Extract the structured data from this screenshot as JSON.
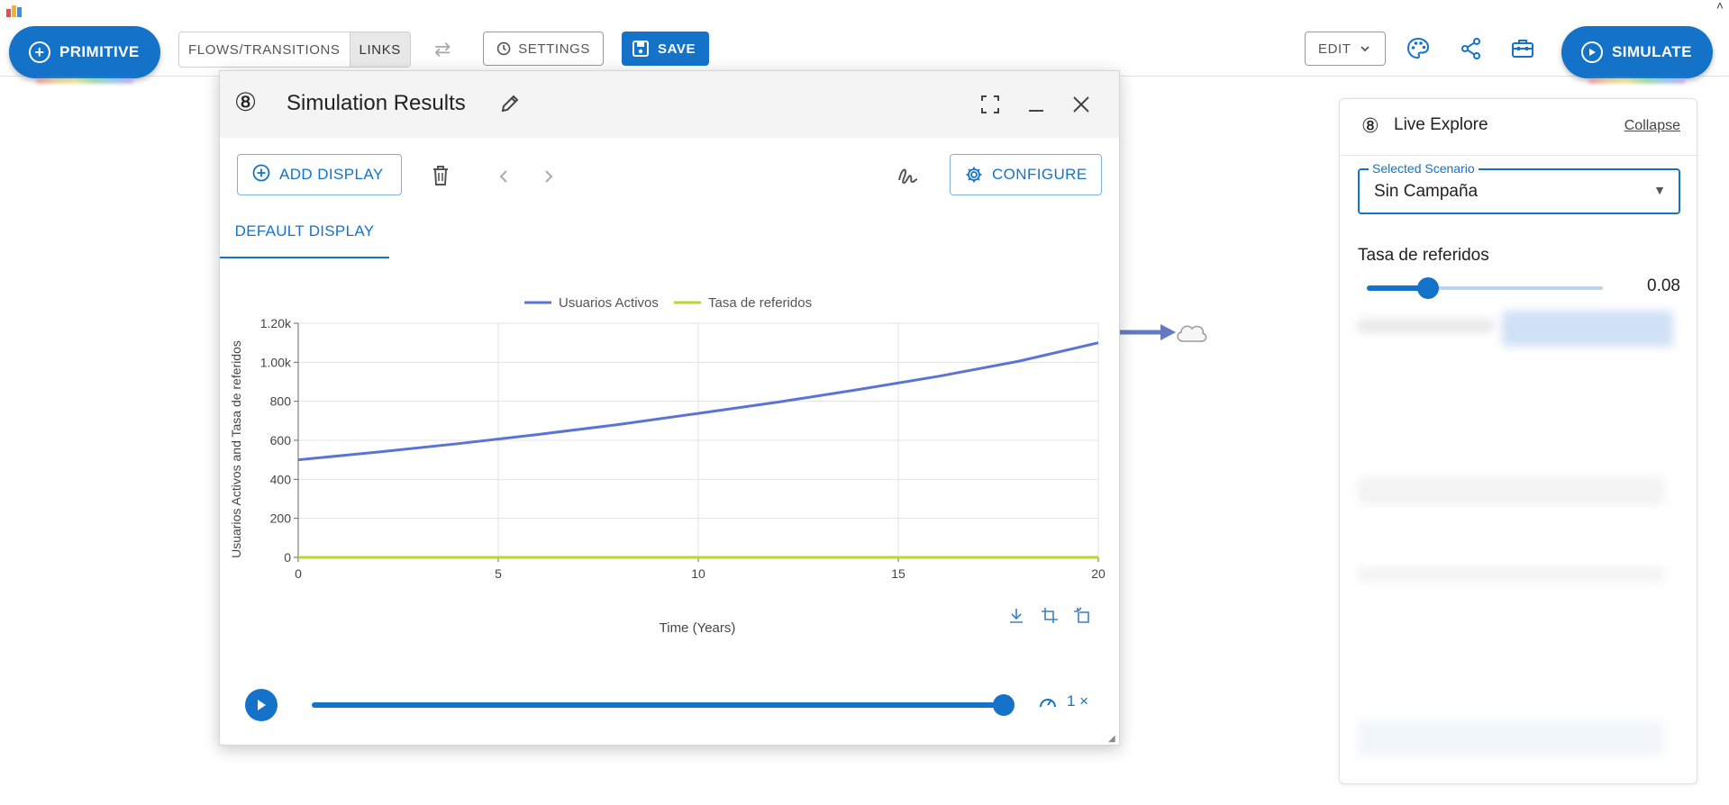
{
  "topbar": {
    "primitive_label": "PRIMITIVE",
    "toggle": [
      "FLOWS/TRANSITIONS",
      "LINKS"
    ],
    "settings_label": "SETTINGS",
    "save_label": "SAVE",
    "edit_label": "EDIT",
    "simulate_label": "SIMULATE"
  },
  "sim_window": {
    "index": "⑧",
    "title": "Simulation Results",
    "add_display_label": "ADD DISPLAY",
    "configure_label": "CONFIGURE",
    "tab_label": "DEFAULT DISPLAY",
    "speed_label": "1 ×"
  },
  "chart_data": {
    "type": "line",
    "xlabel": "Time (Years)",
    "ylabel": "Usuarios Activos and Tasa de referidos",
    "xlim": [
      0,
      20
    ],
    "ylim": [
      0,
      1200
    ],
    "x_ticks": [
      "0",
      "5",
      "10",
      "15",
      "20"
    ],
    "y_ticks": [
      "0",
      "200",
      "400",
      "600",
      "800",
      "1.00k",
      "1.20k"
    ],
    "x_tick_values": [
      0,
      5,
      10,
      15,
      20
    ],
    "y_tick_values": [
      0,
      200,
      400,
      600,
      800,
      1000,
      1200
    ],
    "grid": true,
    "legend_position": "top-center",
    "x": [
      0,
      2,
      4,
      6,
      8,
      10,
      12,
      14,
      16,
      18,
      20
    ],
    "series": [
      {
        "name": "Usuarios Activos",
        "color": "#5b73d6",
        "values": [
          500,
          540,
          583,
          630,
          681,
          738,
          796,
          860,
          928,
          1005,
          1100
        ]
      },
      {
        "name": "Tasa de referidos",
        "color": "#bcd631",
        "values": [
          0.08,
          0.08,
          0.08,
          0.08,
          0.08,
          0.08,
          0.08,
          0.08,
          0.08,
          0.08,
          0.08
        ]
      }
    ]
  },
  "live_explore": {
    "index": "⑧",
    "title": "Live Explore",
    "collapse_label": "Collapse",
    "scenario_label": "Selected Scenario",
    "scenario_value": "Sin Campaña",
    "param_label": "Tasa de referidos",
    "param_value": "0.08",
    "param_fraction": 0.26
  },
  "colors": {
    "accent": "#1473c9",
    "series_1": "#5b73d6",
    "series_2": "#bcd631"
  }
}
